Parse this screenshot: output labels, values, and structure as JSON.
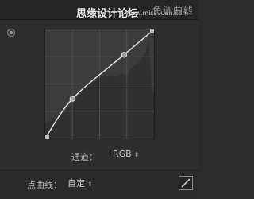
{
  "header": {
    "title": "色调曲线",
    "watermark": "思缘设计论坛",
    "watermark_url": "www.missvuan.com"
  },
  "icons": {
    "target": "target-adjust-icon",
    "edit": "edit-point-curve-icon",
    "channel_caret": "chevron-updown-icon",
    "points_caret": "chevron-updown-icon"
  },
  "curve": {
    "control_points": [
      [
        0,
        0
      ],
      [
        64,
        93
      ],
      [
        185,
        196
      ],
      [
        255,
        255
      ]
    ]
  },
  "channel": {
    "label": "通道：",
    "value": "RGB"
  },
  "point_curve": {
    "label": "点曲线：",
    "value": "自定"
  },
  "colors": {
    "curve_line": "#e8e8e8",
    "histogram": "#2a2a2a",
    "grid": "#4c4c4c"
  }
}
